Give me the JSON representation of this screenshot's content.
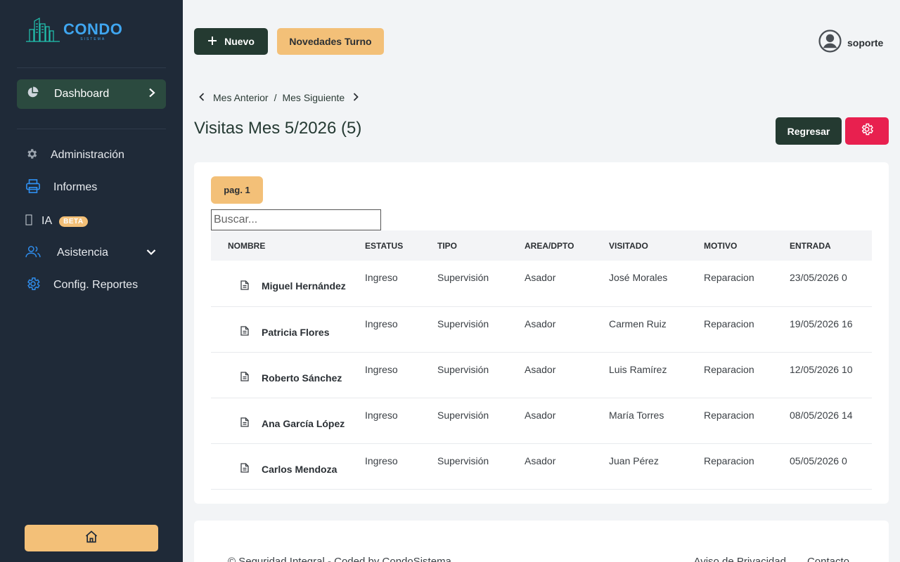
{
  "brand": {
    "name": "CONDO",
    "sub": "SISTEMA",
    "color": "#3fa6f0"
  },
  "sidebar": {
    "dashboard": {
      "label": "Dashboard",
      "icon": "pie-chart-icon"
    },
    "items": [
      {
        "label": "Administración",
        "icon": "gear-icon"
      },
      {
        "label": "Informes",
        "icon": "printer-icon"
      },
      {
        "label": "IA",
        "icon": "missing-glyph-icon",
        "badge": "BETA"
      },
      {
        "label": "Asistencia",
        "icon": "users-icon"
      },
      {
        "label": "Config. Reportes",
        "icon": "gear-outline-icon"
      }
    ]
  },
  "topbar": {
    "new_label": "Nuevo",
    "news_label": "Novedades Turno",
    "user": "soporte"
  },
  "breadcrumb": {
    "prev": "Mes Anterior",
    "sep": "/",
    "next": "Mes Siguiente"
  },
  "page": {
    "title": "Visitas Mes 5/2026 (5)",
    "back_label": "Regresar"
  },
  "card": {
    "page_label": "pag. 1",
    "search_placeholder": "Buscar..."
  },
  "table": {
    "headers": [
      "NOMBRE",
      "ESTATUS",
      "TIPO",
      "AREA/DPTO",
      "VISITADO",
      "MOTIVO",
      "ENTRADA"
    ],
    "rows": [
      [
        "Miguel Hernández",
        "Ingreso",
        "Supervisión",
        "Asador",
        "José Morales",
        "Reparacion",
        "23/05/2026 0"
      ],
      [
        "Patricia Flores",
        "Ingreso",
        "Supervisión",
        "Asador",
        "Carmen Ruiz",
        "Reparacion",
        "19/05/2026 16"
      ],
      [
        "Roberto Sánchez",
        "Ingreso",
        "Supervisión",
        "Asador",
        "Luis Ramírez",
        "Reparacion",
        "12/05/2026 10"
      ],
      [
        "Ana García López",
        "Ingreso",
        "Supervisión",
        "Asador",
        "María Torres",
        "Reparacion",
        "08/05/2026 14"
      ],
      [
        "Carlos Mendoza",
        "Ingreso",
        "Supervisión",
        "Asador",
        "Juan Pérez",
        "Reparacion",
        "05/05/2026 0"
      ]
    ]
  },
  "footer": {
    "copy": "© Seguridad Integral - Coded by CondoSistema",
    "privacy": "Aviso de Privacidad",
    "contact": "Contacto"
  },
  "colors": {
    "sidebar": "#1f2a38",
    "primary": "#243a31",
    "accent": "#f3c078",
    "danger": "#e8204f"
  }
}
